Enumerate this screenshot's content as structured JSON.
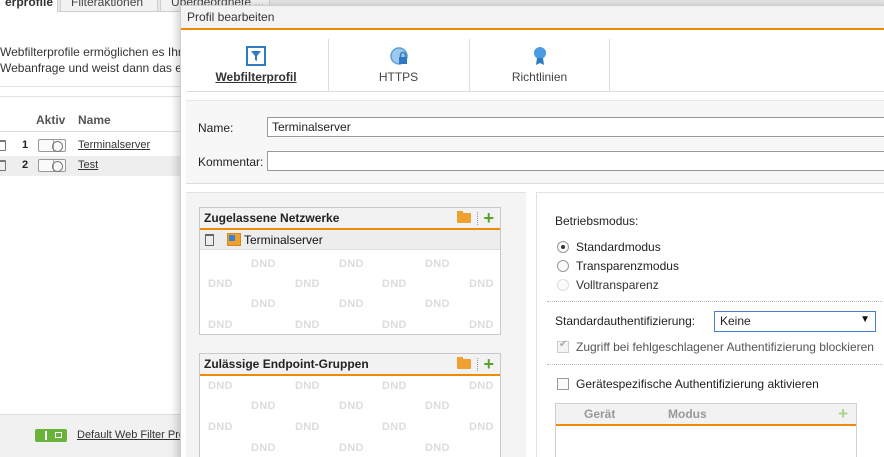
{
  "background": {
    "tabs": [
      "erprofile",
      "Filteraktionen",
      "Übergeordnete ..."
    ],
    "description_line1": "Webfilterprofile ermöglichen es Ihr",
    "description_line2": "Webanfrage und weist dann das e",
    "table": {
      "col_aktiv": "Aktiv",
      "col_name": "Name",
      "rows": [
        {
          "num": "1",
          "name": "Terminalserver"
        },
        {
          "num": "2",
          "name": "Test"
        }
      ]
    },
    "footer_label": "Default Web Filter Profi"
  },
  "dialog": {
    "title": "Profil bearbeiten",
    "toolbar": {
      "webfilter": "Webfilterprofil",
      "https": "HTTPS",
      "richtlinien": "Richtlinien"
    },
    "name_label": "Name:",
    "name_value": "Terminalserver",
    "kommentar_label": "Kommentar:",
    "kommentar_value": "",
    "networks_panel": {
      "title": "Zugelassene Netzwerke",
      "items": [
        "Terminalserver"
      ],
      "dnd_text": "DND"
    },
    "endpoint_panel": {
      "title": "Zulässige Endpoint-Gruppen",
      "dnd_text": "DND"
    },
    "betriebsmodus_label": "Betriebsmodus:",
    "modes": [
      "Standardmodus",
      "Transparenzmodus",
      "Volltransparenz"
    ],
    "selected_mode": "Standardmodus",
    "auth_label": "Standardauthentifizierung:",
    "auth_value": "Keine",
    "block_on_fail_label": "Zugriff bei fehlgeschlagener Authentifizierung blockieren",
    "device_auth_label": "Gerätespezifische Authentifizierung aktivieren",
    "device_table": {
      "col_geraet": "Gerät",
      "col_modus": "Modus"
    }
  },
  "colors": {
    "accent": "#f08a00",
    "add_green": "#5aa02c",
    "icon_blue": "#2e7bc4"
  }
}
